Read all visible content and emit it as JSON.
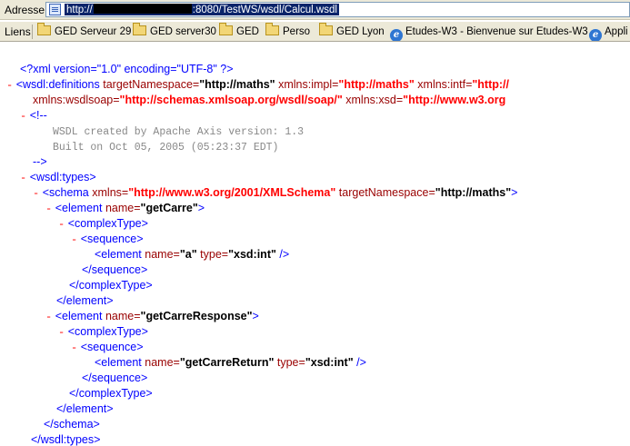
{
  "address_bar": {
    "label": "Adresse",
    "url_prefix": "http://",
    "url_suffix": ":8080/TestWS/wsdl/Calcul.wsdl"
  },
  "links_bar": {
    "label": "Liens",
    "items": [
      {
        "label": "GED Serveur 29",
        "icon": "folder-icon"
      },
      {
        "label": "GED server30",
        "icon": "folder-icon"
      },
      {
        "label": "GED",
        "icon": "folder-icon"
      },
      {
        "label": "Perso",
        "icon": "folder-icon"
      },
      {
        "label": "GED Lyon",
        "icon": "folder-icon"
      },
      {
        "label": "Etudes-W3 - Bienvenue sur Etudes-W3",
        "icon": "ie-page-icon"
      },
      {
        "label": "Appli",
        "icon": "ie-page-icon"
      }
    ]
  },
  "xml": {
    "decl": "<?xml version=\"1.0\" encoding=\"UTF-8\" ?>",
    "definitions": {
      "open": "<wsdl:definitions",
      "targetNamespace_attr": "targetNamespace=",
      "targetNamespace_val": "\"http://maths\"",
      "impl_attr": "xmlns:impl=",
      "impl_val": "\"http://maths\"",
      "intf_attr": "xmlns:intf=",
      "intf_val": "\"http://",
      "wsdlsoap_attr": "xmlns:wsdlsoap=",
      "wsdlsoap_val": "\"http://schemas.xmlsoap.org/wsdl/soap/\"",
      "xsd_attr": "xmlns:xsd=",
      "xsd_val": "\"http://www.w3.org"
    },
    "comment_open": "<!--",
    "comment_line1": "WSDL created by Apache Axis version: 1.3",
    "comment_line2": "Built on Oct 05, 2005 (05:23:37 EDT)",
    "comment_close": "-->",
    "types_open": "<wsdl:types>",
    "schema_open": "<schema",
    "schema_xmlns_attr": "xmlns=",
    "schema_xmlns_val": "\"http://www.w3.org/2001/XMLSchema\"",
    "schema_tns_attr": "targetNamespace=",
    "schema_tns_val": "\"http://maths\"",
    "el1_name": "\"getCarre\"",
    "el1_child_name": "\"a\"",
    "el1_child_type": "\"xsd:int\"",
    "el2_name": "\"getCarreResponse\"",
    "el2_child_name": "\"getCarreReturn\"",
    "el2_child_type": "\"xsd:int\"",
    "element_open": "<element",
    "name_attr": "name=",
    "type_attr": "type=",
    "complexType_open": "<complexType>",
    "sequence_open": "<sequence>",
    "sequence_close": "</sequence>",
    "complexType_close": "</complexType>",
    "element_close": "</element>",
    "schema_close": "</schema>",
    "types_close": "</wsdl:types>",
    "gt": ">",
    "selfclose": "/>",
    "minus": "-"
  }
}
